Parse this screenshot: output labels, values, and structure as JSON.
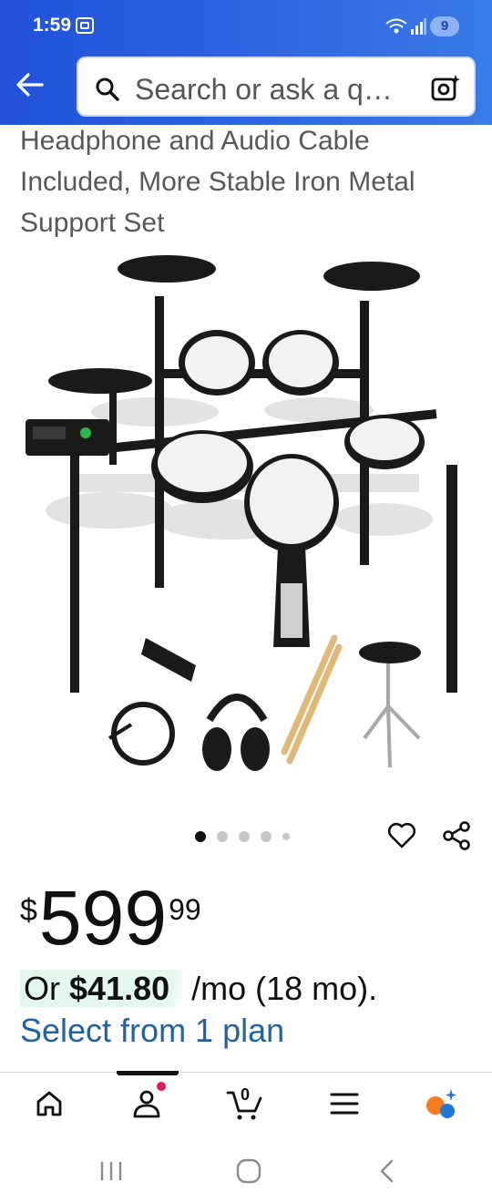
{
  "status_bar": {
    "time": "1:59",
    "battery": "9"
  },
  "search": {
    "placeholder": "Search or ask a q…"
  },
  "product": {
    "title": "Headphone and Audio Cable Included, More Stable Iron Metal Support Set",
    "image": {
      "dot_count": 5,
      "active_dot": 0
    }
  },
  "price": {
    "symbol": "$",
    "whole": "599",
    "fraction": "99"
  },
  "financing": {
    "prefix": "Or ",
    "amount": "$41.80",
    "suffix": " /mo (18 mo).",
    "link": "Select from 1 plan"
  },
  "bottom_nav": {
    "cart_count": "0",
    "items": [
      "home-icon",
      "account-icon",
      "cart-icon",
      "menu-icon",
      "rufus-icon"
    ]
  },
  "colors": {
    "header": "#2a5fe0",
    "link": "#2162a1",
    "highlight": "#e4f7ef",
    "notification": "#e3175a"
  }
}
